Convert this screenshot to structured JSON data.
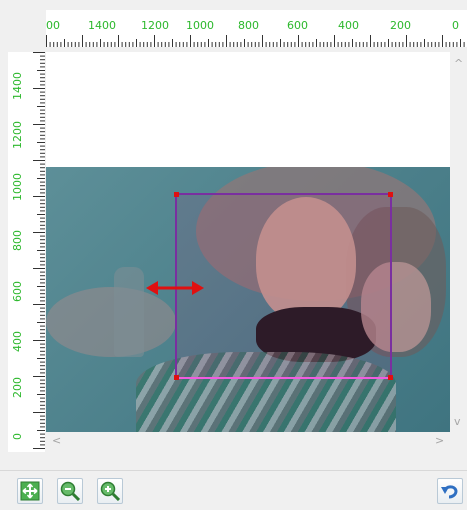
{
  "ruler": {
    "horizontal_labels": [
      "00",
      "1400",
      "1200",
      "1000",
      "800",
      "600",
      "400",
      "200",
      "0"
    ],
    "vertical_labels": [
      "1400",
      "1200",
      "1000",
      "800",
      "600",
      "400",
      "200",
      "0"
    ]
  },
  "colors": {
    "ruler_text": "#2db82d",
    "crop_border": "#7a2fa0",
    "crop_bottom_border": "#f05ce0",
    "handle": "#e01010",
    "resize_arrow": "#e01010"
  },
  "scrollbars": {
    "up": "^",
    "down": "v",
    "left": "<",
    "right": ">"
  },
  "toolbar": {
    "fit_icon": "fit-to-window-icon",
    "zoom_out_icon": "zoom-out-icon",
    "zoom_in_icon": "zoom-in-icon",
    "reset_icon": "undo-icon"
  }
}
